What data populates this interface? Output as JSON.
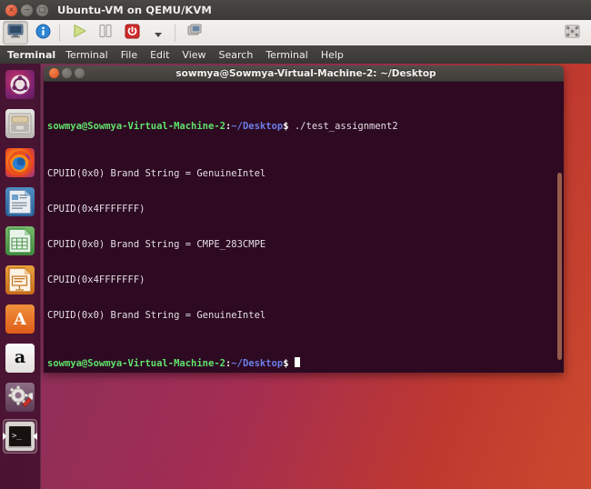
{
  "host_window": {
    "title": "Ubuntu-VM on QEMU/KVM",
    "buttons": {
      "close": "×",
      "minimize": "−",
      "maximize": "□"
    },
    "toolbar": {
      "items": [
        {
          "name": "show-console-view",
          "icon": "monitor-icon",
          "tooltip": "Console",
          "pressed": true
        },
        {
          "name": "show-details-view",
          "icon": "info-icon",
          "tooltip": "Details",
          "pressed": false
        },
        {
          "name": "run-vm",
          "icon": "play-icon",
          "tooltip": "Run",
          "pressed": false
        },
        {
          "name": "pause-vm",
          "icon": "pause-icon",
          "tooltip": "Pause",
          "pressed": false
        },
        {
          "name": "shutdown-vm",
          "icon": "power-icon",
          "tooltip": "Shut Down",
          "pressed": false
        },
        {
          "name": "shutdown-dropdown",
          "icon": "chevron-down-icon",
          "tooltip": "More shutdown options",
          "pressed": false
        },
        {
          "name": "take-snapshot",
          "icon": "snapshot-icon",
          "tooltip": "Snapshots",
          "pressed": false
        }
      ],
      "fullscreen": {
        "name": "fullscreen-button",
        "icon": "fullscreen-icon",
        "tooltip": "Fullscreen"
      }
    }
  },
  "guest_desktop": {
    "panel": {
      "app_name": "Terminal",
      "menu": [
        "Terminal",
        "File",
        "Edit",
        "View",
        "Search",
        "Terminal",
        "Help"
      ]
    },
    "launcher": {
      "items": [
        {
          "label": "Ubuntu Dash",
          "icon": "ubuntu-logo-icon",
          "active": false
        },
        {
          "label": "Files",
          "icon": "files-icon",
          "active": false
        },
        {
          "label": "Firefox Web Browser",
          "icon": "firefox-icon",
          "active": false
        },
        {
          "label": "LibreOffice Writer",
          "icon": "libreoffice-writer-icon",
          "active": false
        },
        {
          "label": "LibreOffice Calc",
          "icon": "libreoffice-calc-icon",
          "active": false
        },
        {
          "label": "LibreOffice Impress",
          "icon": "libreoffice-impress-icon",
          "active": false
        },
        {
          "label": "Ubuntu Software",
          "icon": "ubuntu-software-icon",
          "glyph": "A",
          "active": false
        },
        {
          "label": "Amazon",
          "icon": "amazon-icon",
          "glyph": "a",
          "active": false
        },
        {
          "label": "System Settings",
          "icon": "system-settings-icon",
          "active": false
        },
        {
          "label": "Terminal",
          "icon": "terminal-icon",
          "glyph": ">_",
          "active": true
        }
      ]
    }
  },
  "terminal_window": {
    "title": "sowmya@Sowmya-Virtual-Machine-2: ~/Desktop",
    "buttons": {
      "close": "close-button",
      "minimize": "minimize-button",
      "maximize": "maximize-button"
    },
    "prompt": {
      "user_host": "sowmya@Sowmya-Virtual-Machine-2",
      "separator": ":",
      "path": "~/Desktop",
      "sigil": "$"
    },
    "lines": [
      {
        "type": "prompt",
        "command": " ./test_assignment2"
      },
      {
        "type": "output",
        "text": "CPUID(0x0) Brand String = GenuineIntel"
      },
      {
        "type": "output",
        "text": "CPUID(0x4FFFFFFF)"
      },
      {
        "type": "output",
        "text": "CPUID(0x0) Brand String = CMPE_283CMPE"
      },
      {
        "type": "output",
        "text": "CPUID(0x4FFFFFFF)"
      },
      {
        "type": "output",
        "text": "CPUID(0x0) Brand String = GenuineIntel"
      },
      {
        "type": "prompt",
        "command": " "
      }
    ],
    "colors": {
      "background": "#2d0922",
      "foreground": "#e3dde1",
      "prompt_user": "#60e36a",
      "prompt_path": "#6a7fe8",
      "cursor": "#ffffff"
    }
  }
}
